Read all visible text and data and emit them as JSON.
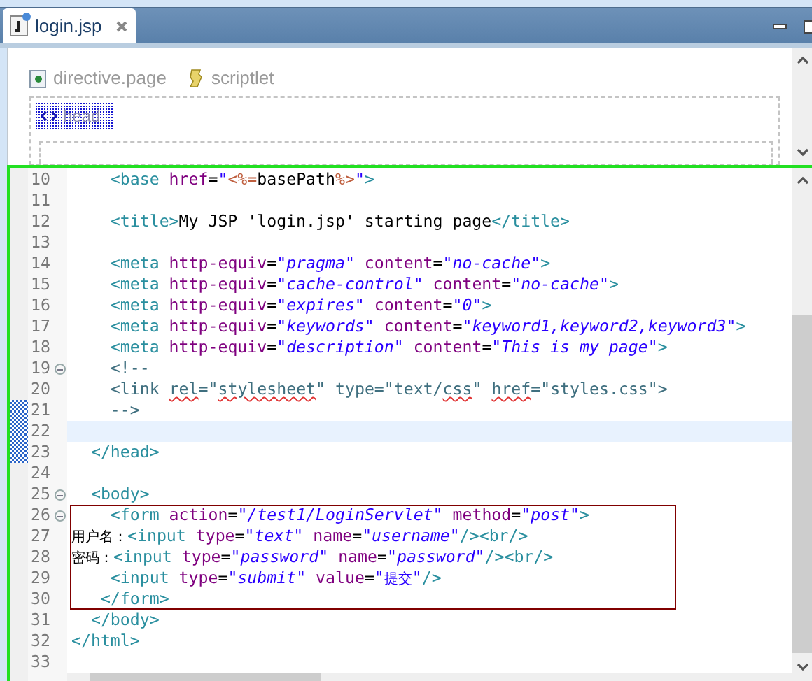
{
  "tabs": [
    {
      "title": "login.jsp",
      "selected": true
    }
  ],
  "design_view": {
    "palette": [
      {
        "label": "directive.page",
        "kind": "directive"
      },
      {
        "label": "scriptlet",
        "kind": "scriptlet"
      }
    ],
    "element": {
      "label": "head",
      "selected": true
    }
  },
  "source": {
    "lines": [
      {
        "number": "10",
        "foldable": false,
        "changed": false,
        "current": false,
        "boxed": false,
        "tokens": [
          {
            "kind": "tag",
            "text": "    <base"
          },
          {
            "kind": "attr",
            "text": " href"
          },
          {
            "kind": "eq",
            "text": "="
          },
          {
            "kind": "str",
            "text": "\""
          },
          {
            "kind": "jsp",
            "text": "<%="
          },
          {
            "kind": "text",
            "text": "basePath"
          },
          {
            "kind": "jsp",
            "text": "%>"
          },
          {
            "kind": "str",
            "text": "\""
          },
          {
            "kind": "tag",
            "text": ">"
          }
        ]
      },
      {
        "number": "11",
        "foldable": false,
        "changed": false,
        "current": false,
        "boxed": false
      },
      {
        "number": "12",
        "foldable": false,
        "changed": false,
        "current": false,
        "boxed": false,
        "tokens": [
          {
            "kind": "tag",
            "text": "    <title>"
          },
          {
            "kind": "text",
            "text": "My JSP 'login.jsp' starting page"
          },
          {
            "kind": "tag",
            "text": "</title>"
          }
        ]
      },
      {
        "number": "13",
        "foldable": false,
        "changed": false,
        "current": false,
        "boxed": false
      },
      {
        "number": "14",
        "foldable": false,
        "changed": false,
        "current": false,
        "boxed": false,
        "tokens": [
          {
            "kind": "tag",
            "text": "    <meta"
          },
          {
            "kind": "attr",
            "text": " http-equiv"
          },
          {
            "kind": "eq",
            "text": "="
          },
          {
            "kind": "str",
            "text": "\"pragma\""
          },
          {
            "kind": "attr",
            "text": " content"
          },
          {
            "kind": "eq",
            "text": "="
          },
          {
            "kind": "str",
            "text": "\"no-cache\""
          },
          {
            "kind": "tag",
            "text": ">"
          }
        ]
      },
      {
        "number": "15",
        "foldable": false,
        "changed": false,
        "current": false,
        "boxed": false,
        "tokens": [
          {
            "kind": "tag",
            "text": "    <meta"
          },
          {
            "kind": "attr",
            "text": " http-equiv"
          },
          {
            "kind": "eq",
            "text": "="
          },
          {
            "kind": "str",
            "text": "\"cache-control\""
          },
          {
            "kind": "attr",
            "text": " content"
          },
          {
            "kind": "eq",
            "text": "="
          },
          {
            "kind": "str",
            "text": "\"no-cache\""
          },
          {
            "kind": "tag",
            "text": ">"
          }
        ]
      },
      {
        "number": "16",
        "foldable": false,
        "changed": false,
        "current": false,
        "boxed": false,
        "tokens": [
          {
            "kind": "tag",
            "text": "    <meta"
          },
          {
            "kind": "attr",
            "text": " http-equiv"
          },
          {
            "kind": "eq",
            "text": "="
          },
          {
            "kind": "str",
            "text": "\"expires\""
          },
          {
            "kind": "attr",
            "text": " content"
          },
          {
            "kind": "eq",
            "text": "="
          },
          {
            "kind": "str",
            "text": "\"0\""
          },
          {
            "kind": "tag",
            "text": ">"
          }
        ]
      },
      {
        "number": "17",
        "foldable": false,
        "changed": false,
        "current": false,
        "boxed": false,
        "tokens": [
          {
            "kind": "tag",
            "text": "    <meta"
          },
          {
            "kind": "attr",
            "text": " http-equiv"
          },
          {
            "kind": "eq",
            "text": "="
          },
          {
            "kind": "str",
            "text": "\"keywords\""
          },
          {
            "kind": "attr",
            "text": " content"
          },
          {
            "kind": "eq",
            "text": "="
          },
          {
            "kind": "str",
            "text": "\"keyword1,keyword2,keyword3\""
          },
          {
            "kind": "tag",
            "text": ">"
          }
        ]
      },
      {
        "number": "18",
        "foldable": false,
        "changed": false,
        "current": false,
        "boxed": false,
        "tokens": [
          {
            "kind": "tag",
            "text": "    <meta"
          },
          {
            "kind": "attr",
            "text": " http-equiv"
          },
          {
            "kind": "eq",
            "text": "="
          },
          {
            "kind": "str",
            "text": "\"description\""
          },
          {
            "kind": "attr",
            "text": " content"
          },
          {
            "kind": "eq",
            "text": "="
          },
          {
            "kind": "str",
            "text": "\"This is my page\""
          },
          {
            "kind": "tag",
            "text": ">"
          }
        ]
      },
      {
        "number": "19",
        "foldable": true,
        "changed": false,
        "current": false,
        "boxed": false,
        "tokens": [
          {
            "kind": "comment",
            "text": "    <!--"
          }
        ]
      },
      {
        "number": "20",
        "foldable": false,
        "changed": false,
        "current": false,
        "boxed": false,
        "tokens": [
          {
            "kind": "comment",
            "text": "    <link "
          },
          {
            "kind": "misspelled",
            "text": "rel"
          },
          {
            "kind": "comment",
            "text": "=\""
          },
          {
            "kind": "misspelled",
            "text": "stylesheet"
          },
          {
            "kind": "comment",
            "text": "\" type=\"text/"
          },
          {
            "kind": "misspelled",
            "text": "css"
          },
          {
            "kind": "comment",
            "text": "\" "
          },
          {
            "kind": "misspelled",
            "text": "href"
          },
          {
            "kind": "comment",
            "text": "=\"styles.css\">"
          }
        ]
      },
      {
        "number": "21",
        "foldable": false,
        "changed": true,
        "current": false,
        "boxed": false,
        "tokens": [
          {
            "kind": "comment",
            "text": "    -->"
          }
        ]
      },
      {
        "number": "22",
        "foldable": false,
        "changed": true,
        "current": true,
        "boxed": false
      },
      {
        "number": "23",
        "foldable": false,
        "changed": true,
        "current": false,
        "boxed": false,
        "tokens": [
          {
            "kind": "tag",
            "text": "  </head>"
          }
        ]
      },
      {
        "number": "24",
        "foldable": false,
        "changed": false,
        "current": false,
        "boxed": false
      },
      {
        "number": "25",
        "foldable": true,
        "changed": false,
        "current": false,
        "boxed": false,
        "tokens": [
          {
            "kind": "tag",
            "text": "  <body>"
          }
        ]
      },
      {
        "number": "26",
        "foldable": true,
        "changed": false,
        "current": false,
        "boxed": true,
        "tokens": [
          {
            "kind": "tag",
            "text": "    <form"
          },
          {
            "kind": "attr",
            "text": " action"
          },
          {
            "kind": "eq",
            "text": "="
          },
          {
            "kind": "str",
            "text": "\"/test1/LoginServlet\""
          },
          {
            "kind": "attr",
            "text": " method"
          },
          {
            "kind": "eq",
            "text": "="
          },
          {
            "kind": "str",
            "text": "\"post\""
          },
          {
            "kind": "tag",
            "text": ">"
          }
        ]
      },
      {
        "number": "27",
        "foldable": false,
        "changed": false,
        "current": false,
        "boxed": true,
        "tokens": [
          {
            "kind": "cjk",
            "text": "用户名："
          },
          {
            "kind": "tag",
            "text": "<input"
          },
          {
            "kind": "attr",
            "text": " type"
          },
          {
            "kind": "eq",
            "text": "="
          },
          {
            "kind": "str",
            "text": "\"text\""
          },
          {
            "kind": "attr",
            "text": " name"
          },
          {
            "kind": "eq",
            "text": "="
          },
          {
            "kind": "str",
            "text": "\"username\""
          },
          {
            "kind": "tag",
            "text": "/><br/>"
          }
        ]
      },
      {
        "number": "28",
        "foldable": false,
        "changed": false,
        "current": false,
        "boxed": true,
        "tokens": [
          {
            "kind": "cjk",
            "text": "密码："
          },
          {
            "kind": "tag",
            "text": "<input"
          },
          {
            "kind": "attr",
            "text": " type"
          },
          {
            "kind": "eq",
            "text": "="
          },
          {
            "kind": "str",
            "text": "\"password\""
          },
          {
            "kind": "attr",
            "text": " name"
          },
          {
            "kind": "eq",
            "text": "="
          },
          {
            "kind": "str",
            "text": "\"password\""
          },
          {
            "kind": "tag",
            "text": "/><br/>"
          }
        ]
      },
      {
        "number": "29",
        "foldable": false,
        "changed": false,
        "current": false,
        "boxed": true,
        "tokens": [
          {
            "kind": "tag",
            "text": "    <input"
          },
          {
            "kind": "attr",
            "text": " type"
          },
          {
            "kind": "eq",
            "text": "="
          },
          {
            "kind": "str",
            "text": "\"submit\""
          },
          {
            "kind": "attr",
            "text": " value"
          },
          {
            "kind": "eq",
            "text": "="
          },
          {
            "kind": "str",
            "text": "\""
          },
          {
            "kind": "cjk-str",
            "text": "提交"
          },
          {
            "kind": "str",
            "text": "\""
          },
          {
            "kind": "tag",
            "text": "/>"
          }
        ]
      },
      {
        "number": "30",
        "foldable": false,
        "changed": false,
        "current": false,
        "boxed": true,
        "tokens": [
          {
            "kind": "tag",
            "text": "   </form>"
          }
        ]
      },
      {
        "number": "31",
        "foldable": false,
        "changed": false,
        "current": false,
        "boxed": false,
        "tokens": [
          {
            "kind": "tag",
            "text": "  </body>"
          }
        ]
      },
      {
        "number": "32",
        "foldable": false,
        "changed": false,
        "current": false,
        "boxed": false,
        "tokens": [
          {
            "kind": "tag",
            "text": "</html>"
          }
        ]
      },
      {
        "number": "33",
        "foldable": false,
        "changed": false,
        "current": false,
        "boxed": false
      }
    ]
  }
}
